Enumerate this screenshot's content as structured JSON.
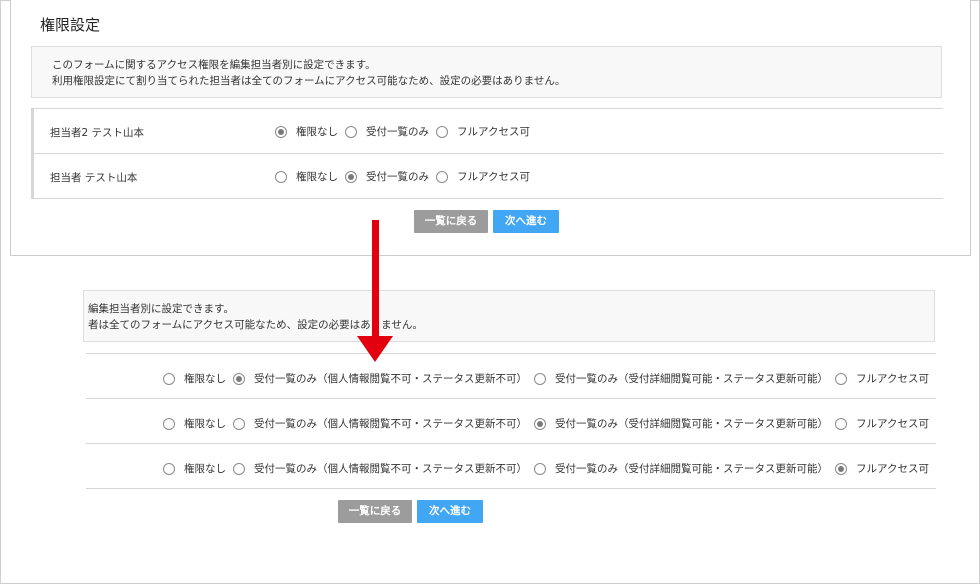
{
  "page": {
    "title": "権限設定",
    "note_lines": [
      "このフォームに関するアクセス権限を編集担当者別に設定できます。",
      "利用権限設定にて割り当てられた担当者は全てのフォームにアクセス可能なため、設定の必要はありません。"
    ],
    "rows": [
      {
        "label": "担当者2 テスト山本",
        "selected": 0
      },
      {
        "label": "担当者 テスト山本",
        "selected": 1
      }
    ],
    "options": [
      "権限なし",
      "受付一覧のみ",
      "フルアクセス可"
    ],
    "buttons": {
      "back": "一覧に戻る",
      "next": "次へ進む"
    }
  },
  "zoomed": {
    "note_lines": [
      "編集担当者別に設定できます。",
      "者は全てのフォームにアクセス可能なため、設定の必要はありません。"
    ],
    "options": [
      "権限なし",
      "受付一覧のみ（個人情報閲覧不可・ステータス更新不可）",
      "受付一覧のみ（受付詳細閲覧可能・ステータス更新可能）",
      "フルアクセス可"
    ],
    "rows": [
      {
        "selected": 1
      },
      {
        "selected": 2
      },
      {
        "selected": 3
      }
    ],
    "buttons": {
      "back": "一覧に戻る",
      "next": "次へ進む"
    }
  },
  "colors": {
    "arrow": "#e3000f",
    "primary_button": "#41a6f4",
    "secondary_button": "#9c9c9c"
  }
}
